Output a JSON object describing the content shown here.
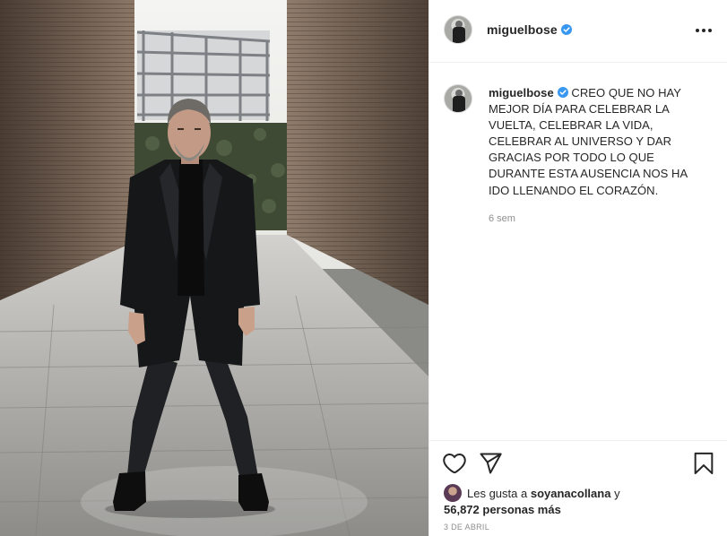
{
  "post": {
    "username": "miguelbose",
    "caption": "CREO QUE NO HAY MEJOR DÍA PARA CELEBRAR LA VUELTA, CELEBRAR LA VIDA, CELEBRAR AL UNIVERSO Y DAR GRACIAS POR TODO LO QUE DURANTE ESTA AUSENCIA NOS HA IDO LLENANDO EL CORAZÓN.",
    "time_ago": "6 sem",
    "date": "3 DE ABRIL"
  },
  "likes": {
    "prefix": "Les gusta a",
    "first_user": "soyanacollana",
    "joiner": "y",
    "others": "56,872 personas más"
  },
  "icons": {
    "more": "more-options-icon",
    "like": "heart-icon",
    "share": "paper-plane-icon",
    "save": "bookmark-icon",
    "verified": "verified-badge-icon"
  },
  "colors": {
    "verified_blue": "#3897f0",
    "text_primary": "#262626",
    "text_secondary": "#8e8e8e",
    "divider": "#efefef"
  }
}
